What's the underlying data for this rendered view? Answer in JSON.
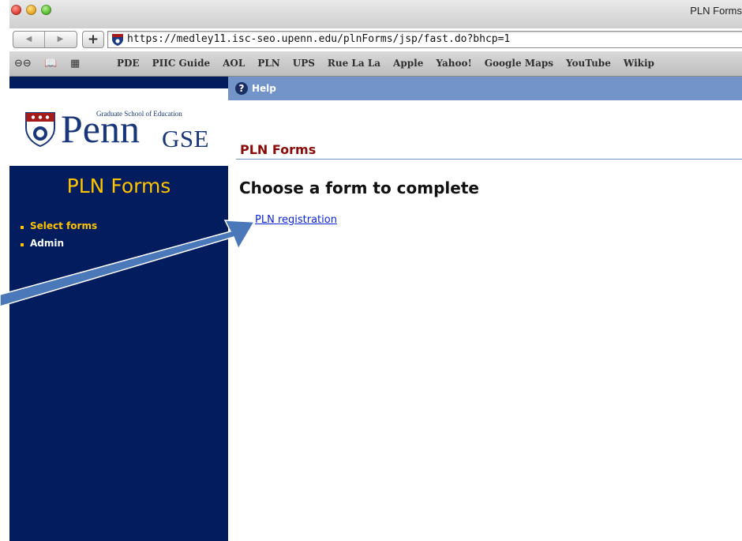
{
  "browser": {
    "window_title": "PLN Forms",
    "url": "https://medley11.isc-seo.upenn.edu/plnForms/jsp/fast.do?bhcp=1",
    "back_icon": "back-arrow-icon",
    "forward_icon": "forward-arrow-icon",
    "add_label": "+",
    "bookmarks": [
      "PDE",
      "PIIC Guide",
      "AOL",
      "PLN",
      "UPS",
      "Rue La La",
      "Apple",
      "Yahoo!",
      "Google Maps",
      "YouTube",
      "Wikip"
    ]
  },
  "sidebar": {
    "logo": {
      "school_line": "Graduate School of Education",
      "penn": "Penn",
      "gse": "GSE"
    },
    "title": "PLN Forms",
    "menu": [
      {
        "label": "Select forms",
        "active": true
      },
      {
        "label": "Admin",
        "active": false
      }
    ]
  },
  "helpbar": {
    "label": "Help"
  },
  "main": {
    "section_title": "PLN Forms",
    "heading": "Choose a form to complete",
    "link": "PLN registration"
  },
  "colors": {
    "sidebar_bg": "#021c5e",
    "accent_yellow": "#ffc400",
    "help_bar": "#7294c8",
    "heading_red": "#8b0a0a",
    "link_blue": "#0a24d6",
    "annotation_arrow": "#4a78b8"
  }
}
